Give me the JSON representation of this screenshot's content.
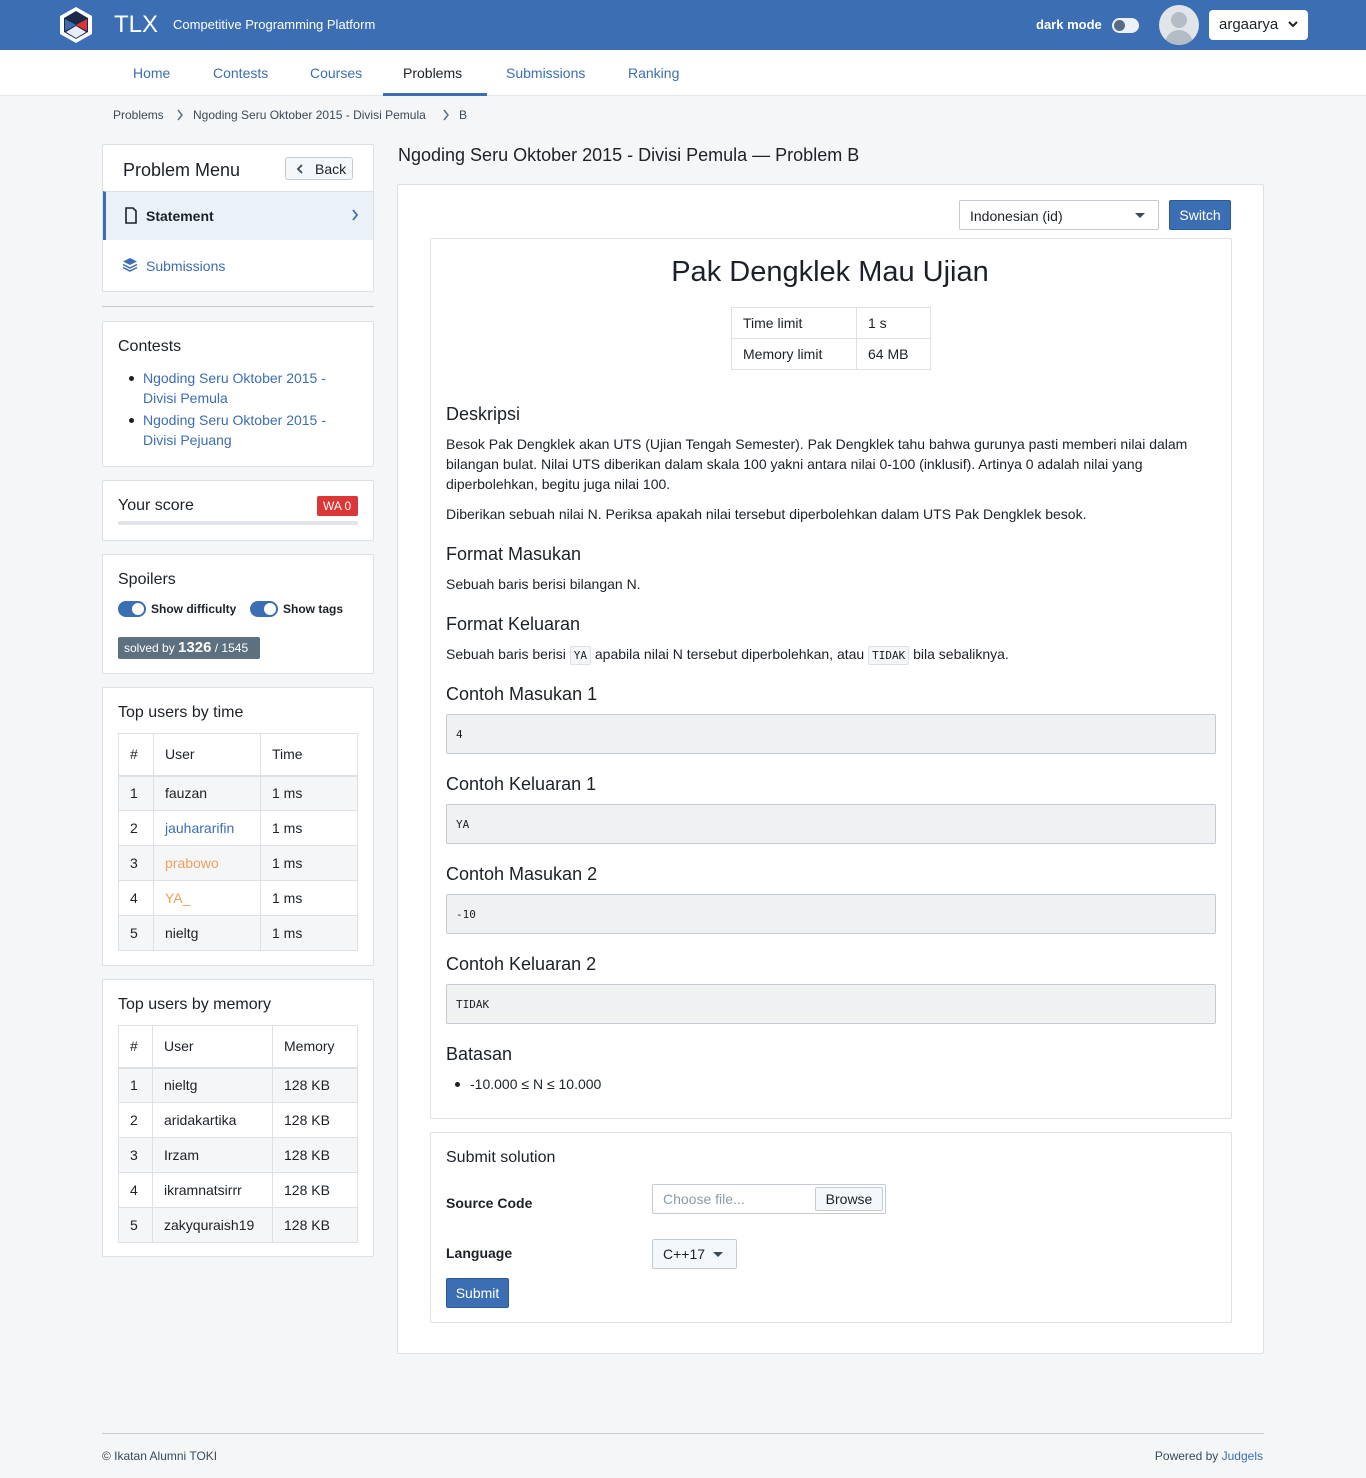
{
  "header": {
    "brand": "TLX",
    "tagline": "Competitive Programming Platform",
    "dark_mode_label": "dark mode",
    "username": "argaarya"
  },
  "nav": {
    "tabs": [
      "Home",
      "Contests",
      "Courses",
      "Problems",
      "Submissions",
      "Ranking"
    ],
    "active": "Problems"
  },
  "breadcrumb": [
    "Problems",
    "Ngoding Seru Oktober 2015 - Divisi Pemula",
    "B"
  ],
  "problem_menu": {
    "title": "Problem Menu",
    "back_label": "Back",
    "items": [
      {
        "label": "Statement",
        "active": true
      },
      {
        "label": "Submissions",
        "active": false
      }
    ]
  },
  "contests": {
    "title": "Contests",
    "items": [
      "Ngoding Seru Oktober 2015 - Divisi Pemula",
      "Ngoding Seru Oktober 2015 - Divisi Pejuang"
    ]
  },
  "score": {
    "title": "Your score",
    "badge": "WA 0"
  },
  "spoilers": {
    "title": "Spoilers",
    "show_difficulty": "Show difficulty",
    "show_tags": "Show tags",
    "solved_prefix": "solved by",
    "solved_count": "1326",
    "solved_total": "/ 1545"
  },
  "top_time": {
    "title": "Top users by time",
    "headers": [
      "#",
      "User",
      "Time"
    ],
    "rows": [
      [
        "1",
        "fauzan",
        "1 ms"
      ],
      [
        "2",
        "jauhararifin",
        "1 ms"
      ],
      [
        "3",
        "prabowo",
        "1 ms"
      ],
      [
        "4",
        "YA_",
        "1 ms"
      ],
      [
        "5",
        "nieltg",
        "1 ms"
      ]
    ]
  },
  "top_memory": {
    "title": "Top users by memory",
    "headers": [
      "#",
      "User",
      "Memory"
    ],
    "rows": [
      [
        "1",
        "nieltg",
        "128 KB"
      ],
      [
        "2",
        "aridakartika",
        "128 KB"
      ],
      [
        "3",
        "Irzam",
        "128 KB"
      ],
      [
        "4",
        "ikramnatsirrr",
        "128 KB"
      ],
      [
        "5",
        "zakyquraish19",
        "128 KB"
      ]
    ]
  },
  "main": {
    "page_title": "Ngoding Seru Oktober 2015 - Divisi Pemula — Problem B",
    "language_selected": "Indonesian (id)",
    "switch_label": "Switch",
    "problem_name": "Pak Dengklek Mau Ujian",
    "limits": [
      {
        "label": "Time limit",
        "value": "1 s"
      },
      {
        "label": "Memory limit",
        "value": "64 MB"
      }
    ],
    "deskripsi_title": "Deskripsi",
    "deskripsi_p1": "Besok Pak Dengklek akan UTS (Ujian Tengah Semester). Pak Dengklek tahu bahwa gurunya pasti memberi nilai dalam bilangan bulat. Nilai UTS diberikan dalam skala 100 yakni antara nilai 0-100 (inklusif). Artinya 0 adalah nilai yang diperbolehkan, begitu juga nilai 100.",
    "deskripsi_p2": "Diberikan sebuah nilai N. Periksa apakah nilai tersebut diperbolehkan dalam UTS Pak Dengklek besok.",
    "format_masukan_title": "Format Masukan",
    "format_masukan_text": "Sebuah baris berisi bilangan N.",
    "format_keluaran_title": "Format Keluaran",
    "format_keluaran_pre": "Sebuah baris berisi",
    "format_keluaran_code1": "YA",
    "format_keluaran_mid": "apabila nilai N tersebut diperbolehkan, atau",
    "format_keluaran_code2": "TIDAK",
    "format_keluaran_post": "bila sebaliknya.",
    "samples": [
      {
        "title": "Contoh Masukan 1",
        "content": "4"
      },
      {
        "title": "Contoh Keluaran 1",
        "content": "YA"
      },
      {
        "title": "Contoh Masukan 2",
        "content": "-10"
      },
      {
        "title": "Contoh Keluaran 2",
        "content": "TIDAK"
      }
    ],
    "batasan_title": "Batasan",
    "batasan_item": "-10.000 ≤ N ≤ 10.000"
  },
  "submit": {
    "title": "Submit solution",
    "source_label": "Source Code",
    "file_placeholder": "Choose file...",
    "browse_label": "Browse",
    "language_label": "Language",
    "language_value": "C++17",
    "submit_label": "Submit"
  },
  "footer": {
    "left": "© Ikatan Alumni TOKI",
    "powered": "Powered by",
    "powered_link": "Judgels"
  }
}
